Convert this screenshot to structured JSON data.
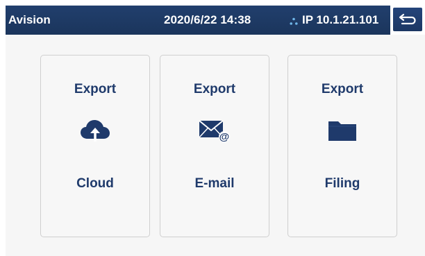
{
  "header": {
    "brand": "Avision",
    "datetime": "2020/6/22 14:38",
    "ip": "IP 10.1.21.101",
    "network_icon": "network-icon",
    "back_icon": "back-arrow-icon"
  },
  "cards": [
    {
      "title": "Export",
      "label": "Cloud",
      "icon": "cloud-upload-icon"
    },
    {
      "title": "Export",
      "label": "E-mail",
      "icon": "email-icon"
    },
    {
      "title": "Export",
      "label": "Filing",
      "icon": "folder-icon"
    }
  ],
  "colors": {
    "header_bg": "#1e3a64",
    "accent": "#1f3a6b",
    "card_bg": "#f7f7f7",
    "screen_bg": "#f6f6f6"
  }
}
